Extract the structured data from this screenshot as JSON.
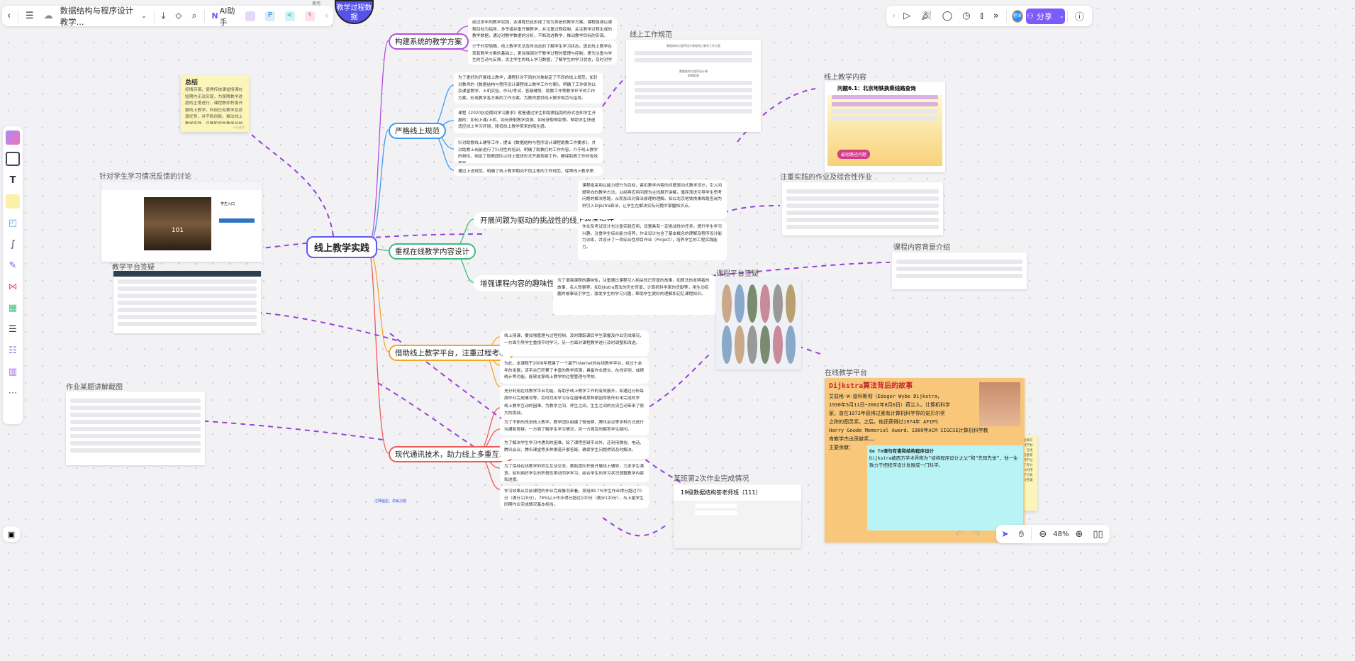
{
  "topbar": {
    "back_icon": "chevron-left-icon",
    "menu_icon": "menu-icon",
    "cloud_icon": "cloud-synced-icon",
    "doc_title": "数据结构与程序设计教学...",
    "download_icon": "download-icon",
    "tag_icon": "tag-icon",
    "search_icon": "search-icon",
    "ai_label": "AI助手",
    "plugins": [
      "image-plugin-icon",
      "p-plugin-icon",
      "share-plugin-icon",
      "flow-plugin-icon"
    ],
    "collapse_icon": "chevron-left-icon"
  },
  "topright": {
    "expand_icon": "chevron-right-icon",
    "tools": [
      "play-icon",
      "celebrate-icon",
      "comment-icon",
      "timer-icon",
      "vote-icon",
      "more-icon"
    ],
    "avatar": "星球",
    "share_label": "分享",
    "help_icon": "help-icon"
  },
  "purple_node": {
    "label": "教学过程数据",
    "tag": "使用"
  },
  "center": {
    "label": "线上教学实践"
  },
  "branches": {
    "b1": "构建系统的教学方案",
    "b2": "严格线上规范",
    "b3": "重视在线教学内容设计",
    "b3a": "开展问题为驱动的挑战性的线上教学设计",
    "b3b": "增强课程内容的趣味性",
    "b4": "借助线上教学平台，注重过程考核",
    "b5": "现代通讯技术，助力线上多重互动"
  },
  "cards": [
    "经过多年的教学实践，本课程已经形成了较为系统的教学方案。课程强调以课程目标为指导，多举措并重开展教学，并注重过程控制，关注教学过程生成的教学数据，通过对教学数据的分析，不断改进教学，推动教学目标的实现。",
    "介于时空阻隔，线上教学无法及时动态的了解学生学习状态。因此线上教学在现有教学方案的基础上，更加强调对于教学过程的管理与控制，更为注重与学生的互动与反馈，关注学生的线上学习数据，了解学生的学习状态，及时对学生开展针对性的指导与帮扶。",
    "为了更好的开展线上教学，课程针对不同的对象制定了不同的线上规范。如针对教师的《数据结构与程序设计课程线上教学工作方案》，明确了工作原则以及课堂教学、上机实验、作业/考试、答疑辅导、助教工作等教学环节的工作方案，形成教学各方面的工作方案。为教师提供线上教学规范与指导。",
    "课程《2020抗疫期间学习要求》就是通过学生和助教指南的形式告知学生开展的：如何上课/上机、如何获取教学资源、如何获取帮助等。帮助学生快速适应线上学习环境，降低线上教学带来的陌生感。",
    "针对助教线上辅导工作，提出《数据结构与程序设计课程助教工作要求》，并对助教上岗前进行了针对性的培训，明确了助教们的工作内容。介于线上教学的特性，制定了助教团队以线上值班形式开展答疑工作，确保助教工作的有效展开。",
    "通过上述规范，明确了线上教学期间不同主体的工作规范，保障线上教学质量。",
    "课程组采用以能力提升为目标，紧扣教学内容的问题驱动式教学设计，引入问题导向的教学方法，以经典应用问题为主线展开讲解，循序渐进引导学生思考问题的解决思路，从而加深对算法原理的理解。如以北京地铁换乘线路查询为例引入Dijkstra算法，让学生在解决实际问题中掌握知识点。",
    "作业及考试设计也注重实践应用，设置具有一定挑战性的任务，提升学生学习兴趣。注重学生综合能力培养，作业设计包含了基本概念的理解及程序设计能力训练，并设计了一项综合性项目作业（Project），培养学生的工程实践能力。",
    "为了增强课程的趣味性，注重通过课程引入相关知识背景的故事，如算法的发明者的故事、名人轶事等。如Dijkstra算法的历史背景、计算机科学家的贡献等，用生动有趣的故事吸引学生，激发学生的学习兴趣，帮助学生更好的理解和记忆课程知识。",
    "线上授课，要加强管理与过程控制，及时跟踪课后学生掌握及作业完成情况，一方面引导学生重视平时学习，另一方面对课程教学进行及时调整和改进。",
    "为此，本课程于2008年搭建了一个基于Internet的在线教学平台，经过十余年的发展，该平台已积累了丰富的教学资源，具备作业提交、在线评测、成绩统计等功能，能够支撑线上教学的过程管理与考核。",
    "充分利用在线教学平台功能，有助于线上教学工作的有效展开。如通过分析每周作业完成情况等，及时找出学习存在困难或某种原因导致作业未完成的学生，针对性的帮扶或督促；利用平台作业查重功能，及时发现参考他人作业的情况，及时提醒同学们独立完成作业。",
    "线上教学互动的困难，为教学之间、师生之间、生生之间的交流互动带来了很大的挑战。",
    "为了不断的改进线上教学，教学团队组建了微信群、腾讯会议等多种方式进行沟通和答疑，一方面了解学生学习情况，另一方面及时解答学生疑问。",
    "为了解决学生学习中遇到的困难，除了课程答疑平台外，还利用微信、电话、腾讯会议、腾讯课堂等多种渠道开展答疑，确保学生问题得到及时解决。",
    "为了保持在线教学的师生互动交流，教助团队积极开展线上辅导，力求学生满意。如利用好学生的积极性带动同学学习，结合学生的学习状况调整教学内容和进度。",
    "学习效果从目前课程的作业完成情况来看，某班89.7%学生作业得分超过70分（满分120分），78%以上作业得分超过100分（满分120分），与上届学生同期作业完成情况基本相当。"
  ],
  "card_highlight": "教学方案",
  "sticky_left": {
    "title": "总结",
    "body": "疫情突袭，使得传统课堂授课在短期内无法实现，为保障教学进度的正常进行，课程教师积极开展线上教学，利用已有教学及资源优势，并不断创新，推动线上教学实践，开展阶段性教学总结与分析，实现教学的持续改进，力争在这一史无前例的实践中取得好成绩。",
    "author": "小石老师"
  },
  "sticky_right": {
    "body": "通过在线教学平台能够开展包括学生管理、教学材料管理、作业管理、在线评测、成绩统计、查重等多项功能。为线上教学过程管理与考核提供了有力保障，助教团队可以利用平台及时了解学生学习状态，对学生进行针对性辅导。"
  },
  "images": {
    "work_spec": {
      "label": "线上工作规范",
      "title": "数据结构与程序设计课程线上教学工作方案",
      "title2": "数据结构与程序设计课",
      "subtitle": "助教职责"
    },
    "content": {
      "label": "线上教学内容",
      "title": "问题6.1：北京地铁换乘线路查询",
      "stamp": "最短路径问题"
    },
    "practice": {
      "label": "注重实践的作业及综合性作业"
    },
    "background": {
      "label": "课程内容背景介绍"
    },
    "class_qa": {
      "label": "课程平台签疑"
    },
    "platform": {
      "label": "在线教学平台",
      "title": "Dijkstra算法背后的故事",
      "lines": [
        "艾兹格·W·迪科斯彻（Edsger Wybe Dijkstra，",
        "1930年5月11日~2002年8月6日）荷兰人。计算机科学",
        "家，曾在1972年获得过素有计算机科学界的诺贝尔奖",
        "之称的图灵奖，之后，他还获得过1974年 AFIPS",
        "Harry Goode Memorial Award、1989年ACM SIGCSE计算机科学教",
        "育教学杰出贡献奖……",
        "主要贡献："
      ],
      "popup_title": "Go To语句有害和结构程序设计",
      "popup_body": "Dijkstra被西方学术界称为“结构程序设计之父”和“先知先觉”，他一生致力于把程序设计发展成一门科学。"
    },
    "homework": {
      "label": "某班第2次作业完成情况",
      "group_title": "19级数据结构答老师班（111）"
    },
    "discussion": {
      "label": "针对学生学习情况反馈的讨论",
      "login_title": "学生入口",
      "badge": "101"
    },
    "qa_platform": {
      "label": "教学平台签疑"
    },
    "explain": {
      "label": "作业某题讲解截图"
    }
  },
  "footer_note": "注释题型，讲解习题",
  "left_toolbar": [
    "template-icon",
    "frame-icon",
    "text-icon",
    "sticky-note-icon",
    "shape-icon",
    "connector-icon",
    "pen-icon",
    "mindmap-icon",
    "table-icon",
    "doc-icon",
    "list-icon",
    "kanban-icon",
    "more-icon"
  ],
  "bottom_left": {
    "icon": "minimap-icon"
  },
  "bottom_right": {
    "undo_icon": "undo-icon",
    "redo_icon": "redo-icon",
    "select_icon": "cursor-icon",
    "hand_icon": "hand-icon",
    "zoom_out_icon": "zoom-out-icon",
    "zoom": "48%",
    "zoom_in_icon": "zoom-in-icon",
    "book_icon": "book-icon"
  },
  "colors": {
    "purple": "#b34fe0",
    "blue": "#3c9af5",
    "green": "#3dbd7d",
    "orange": "#f5a623",
    "red": "#ef5a5a",
    "center": "#5b5bf0",
    "accent": "#7b5cfa",
    "dashed": "#9b40d8"
  }
}
